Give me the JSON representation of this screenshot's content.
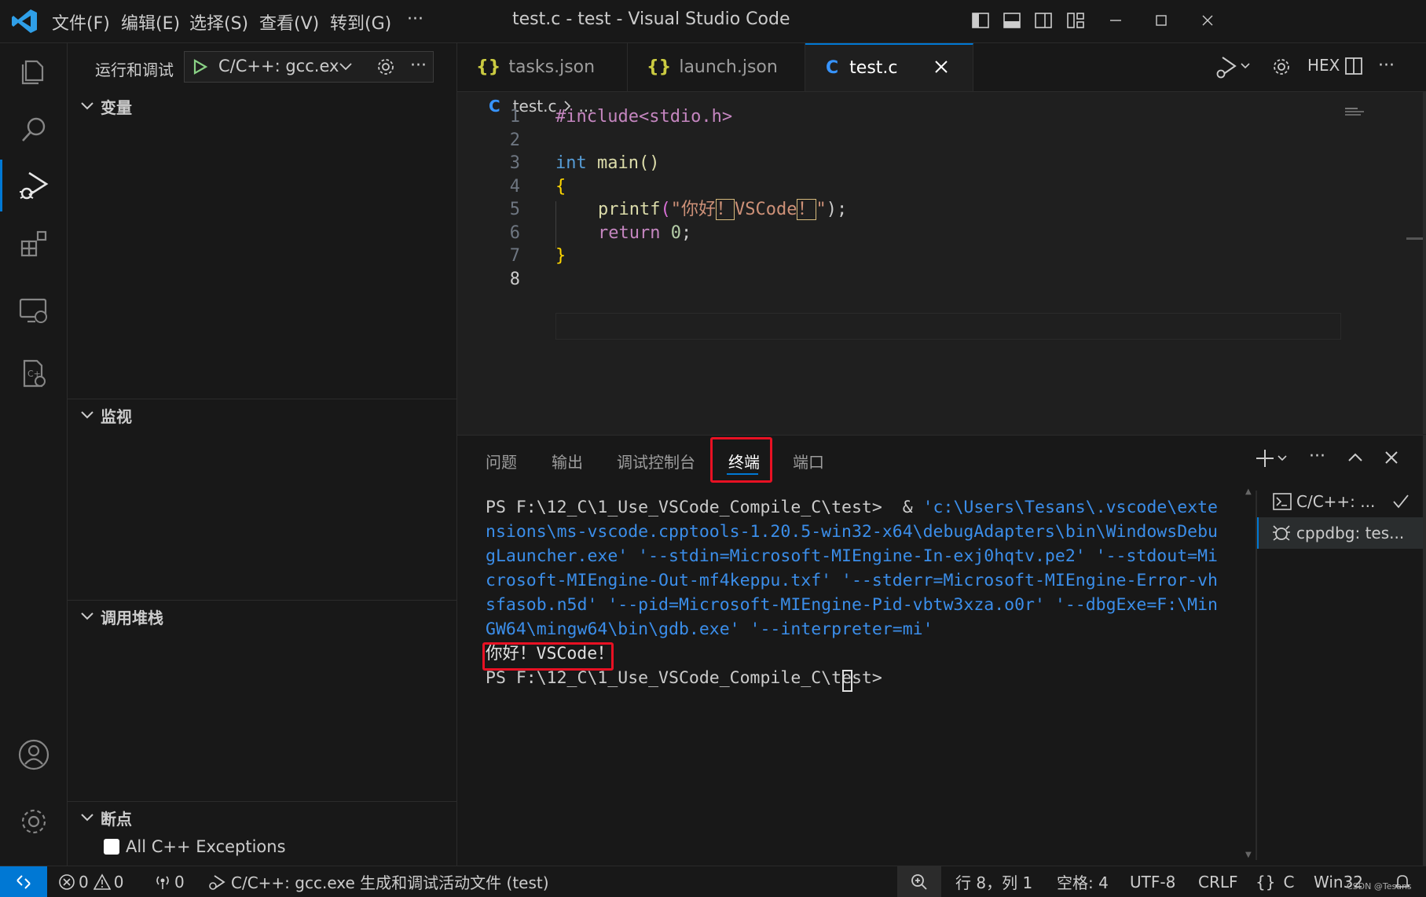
{
  "window": {
    "title": "test.c - test - Visual Studio Code",
    "menu": [
      "文件(F)",
      "编辑(E)",
      "选择(S)",
      "查看(V)",
      "转到(G)",
      "···"
    ]
  },
  "sidebar": {
    "header_title": "运行和调试",
    "launch_config": "C/C++: gcc.ex",
    "sections": {
      "variables": "变量",
      "watch": "监视",
      "call_stack": "调用堆栈",
      "breakpoints": "断点"
    },
    "breakpoint_item": "All C++ Exceptions"
  },
  "editor": {
    "tabs": [
      {
        "icon": "{}",
        "label": "tasks.json"
      },
      {
        "icon": "{}",
        "label": "launch.json"
      },
      {
        "icon": "C",
        "label": "test.c"
      }
    ],
    "breadcrumb": {
      "icon": "C",
      "file": "test.c",
      "rest": "..."
    },
    "toolbar_hex": "HEX",
    "line_numbers": [
      "1",
      "2",
      "3",
      "4",
      "5",
      "6",
      "7",
      "8"
    ],
    "code": {
      "l1": "#include<stdio.h>",
      "l3_kw": "int",
      "l3_fn": " main()",
      "l4": "{",
      "l5_fn": "printf",
      "l5_paren": "(",
      "l5_str_a": "\"你好",
      "l5_mark1": "！",
      "l5_str_b": "VSCode",
      "l5_mark2": "！",
      "l5_str_c": "\"",
      "l5_end": ");",
      "l6_kw": "return",
      "l6_num": "0",
      "l6_end": ";",
      "l7": "}"
    }
  },
  "panel": {
    "tabs": [
      "问题",
      "输出",
      "调试控制台",
      "终端",
      "端口"
    ],
    "active_tab": "终端",
    "terminal": {
      "prompt1": "PS F:\\12_C\\1_Use_VSCode_Compile_C\\test> ",
      "amp": " & ",
      "cmd_lines": [
        "'c:\\Users\\Tesans\\.vscode\\exte",
        "nsions\\ms-vscode.cpptools-1.20.5-win32-x64\\debugAdapters\\bin\\WindowsDebu",
        "gLauncher.exe' '--stdin=Microsoft-MIEngine-In-exj0hqtv.pe2' '--stdout=Mi",
        "crosoft-MIEngine-Out-mf4keppu.txf' '--stderr=Microsoft-MIEngine-Error-vh",
        "sfasob.n5d' '--pid=Microsoft-MIEngine-Pid-vbtw3xza.o0r' '--dbgExe=F:\\Min",
        "GW64\\mingw64\\bin\\gdb.exe' '--interpreter=mi'"
      ],
      "output": "你好！VSCode！",
      "prompt2": "PS F:\\12_C\\1_Use_VSCode_Compile_C\\test> "
    },
    "terminal_list": [
      {
        "icon": "terminal-icon",
        "label": "C/C++: ..."
      },
      {
        "icon": "debug-icon",
        "label": "cppdbg: tes..."
      }
    ]
  },
  "statusbar": {
    "errors": "0",
    "warnings": "0",
    "ports": "0",
    "task": "C/C++: gcc.exe 生成和调试活动文件 (test)",
    "position": "行 8，列 1",
    "spaces": "空格: 4",
    "encoding": "UTF-8",
    "eol": "CRLF",
    "lang_icon": "{}",
    "language": "C",
    "platform": "Win32",
    "watermark": "CSDN @Tesans"
  },
  "colors": {
    "accent": "#0078d4",
    "highlight_box": "#e81123",
    "keyword": "#569cd6",
    "string": "#ce9178",
    "function": "#dcdcaa",
    "preprocessor": "#c586c0",
    "number": "#b5cea8",
    "terminal_link": "#3b8eea"
  }
}
